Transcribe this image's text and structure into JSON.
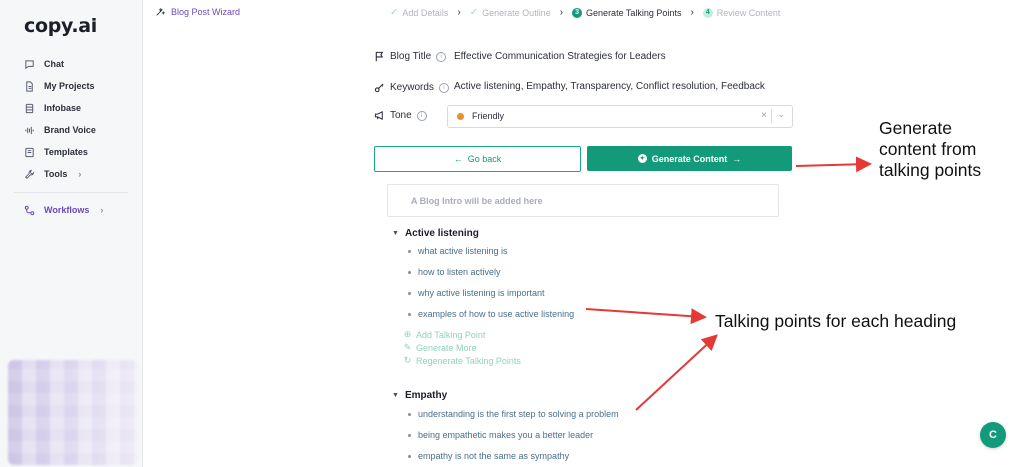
{
  "sidebar": {
    "logo": "copy.ai",
    "items": [
      {
        "label": "Chat",
        "icon": "chat-icon"
      },
      {
        "label": "My Projects",
        "icon": "file-icon"
      },
      {
        "label": "Infobase",
        "icon": "database-icon"
      },
      {
        "label": "Brand Voice",
        "icon": "audio-wave-icon"
      },
      {
        "label": "Templates",
        "icon": "template-icon"
      },
      {
        "label": "Tools",
        "icon": "wrench-icon"
      }
    ],
    "workflows": {
      "label": "Workflows",
      "icon": "workflow-icon"
    }
  },
  "header": {
    "wizard_label": "Blog Post Wizard",
    "steps": [
      {
        "label": "Add Details",
        "state": "done"
      },
      {
        "label": "Generate Outline",
        "state": "done"
      },
      {
        "label": "Generate Talking Points",
        "state": "current",
        "number": "3"
      },
      {
        "label": "Review Content",
        "state": "upcoming",
        "number": "4"
      }
    ]
  },
  "form": {
    "title_label": "Blog Title",
    "title_value": "Effective Communication Strategies for Leaders",
    "keywords_label": "Keywords",
    "keywords_value": "Active listening, Empathy, Transparency, Conflict resolution, Feedback",
    "tone_label": "Tone",
    "tone_value": "Friendly",
    "tone_color": "#e8902a"
  },
  "buttons": {
    "back": "Go back",
    "generate": "Generate Content"
  },
  "intro_placeholder": "A Blog Intro will be added here",
  "sections": [
    {
      "heading": "Active listening",
      "points": [
        "what active listening is",
        "how to listen actively",
        "why active listening is important",
        "examples of how to use active listening"
      ],
      "actions": [
        "Add Talking Point",
        "Generate More",
        "Regenerate Talking Points"
      ]
    },
    {
      "heading": "Empathy",
      "points": [
        "understanding is the first step to solving a problem",
        "being empathetic makes you a better leader",
        "empathy is not the same as sympathy"
      ]
    }
  ],
  "annotations": {
    "generate": "Generate content from talking points",
    "talking_points": "Talking points for each heading"
  },
  "help_label": "C",
  "colors": {
    "accent": "#129a7a",
    "nav_active": "#6c4ab8",
    "annotation_arrow": "#e53935"
  }
}
